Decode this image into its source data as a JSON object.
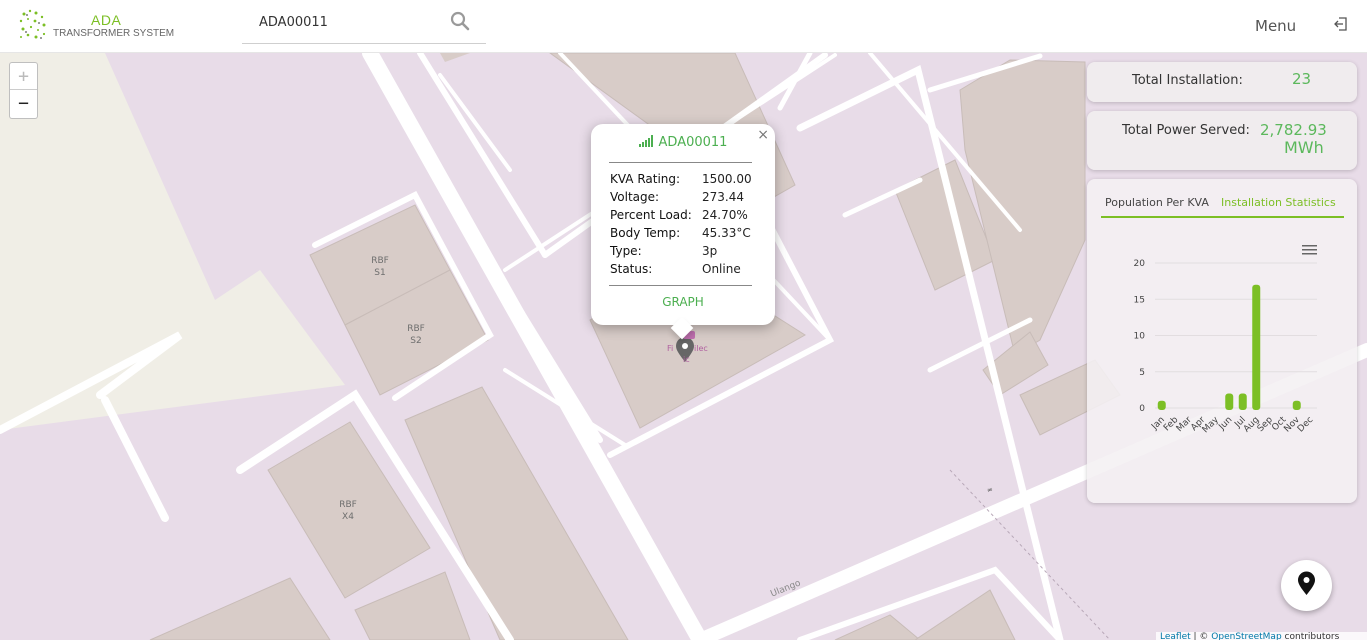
{
  "header": {
    "logo_title": "ADA",
    "logo_subtitle": "TRANSFORMER SYSTEM",
    "search_value": "ADA00011",
    "menu_label": "Menu"
  },
  "map": {
    "zoom_in": "+",
    "zoom_out": "−",
    "labels": [
      {
        "text": "RBF\nS1"
      },
      {
        "text": "RBF\nS2"
      },
      {
        "text": "RBF\nX4"
      },
      {
        "text": "Ulango"
      }
    ],
    "attribution": {
      "leaflet": "Leaflet",
      "sep": " | © ",
      "osm": "OpenStreetMap",
      "rest": " contributors"
    }
  },
  "popup": {
    "close": "×",
    "title": "ADA00011",
    "rows": [
      {
        "label": "KVA Rating:",
        "value": "1500.00"
      },
      {
        "label": "Voltage:",
        "value": "273.44"
      },
      {
        "label": "Percent Load:",
        "value": "24.70%"
      },
      {
        "label": "Body Temp:",
        "value": "45.33°C"
      },
      {
        "label": "Type:",
        "value": "3p"
      },
      {
        "label": "Status:",
        "value": "Online"
      }
    ],
    "graph_label": "GRAPH"
  },
  "stats": {
    "total_installation_label": "Total Installation:",
    "total_installation_value": "23",
    "total_power_label": "Total Power Served:",
    "total_power_value": "2,782.93",
    "total_power_unit": "MWh"
  },
  "tabs": [
    {
      "label": "Population Per KVA",
      "active": false
    },
    {
      "label": "Installation Statistics",
      "active": true
    }
  ],
  "colors": {
    "accent": "#7cbf25",
    "value_green": "#5cb85c",
    "map_bg": "#e8dce8",
    "building": "#d8ccc8"
  },
  "icons": {
    "search": "search-icon",
    "logout": "logout-icon",
    "menu": "hamburger-icon",
    "locate": "location-pin-icon",
    "signal": "signal-icon"
  },
  "chart_data": {
    "type": "bar",
    "categories": [
      "Jan",
      "Feb",
      "Mar",
      "Apr",
      "May",
      "Jun",
      "Jul",
      "Aug",
      "Sep",
      "Oct",
      "Nov",
      "Dec"
    ],
    "values": [
      1,
      0,
      0,
      0,
      0,
      2,
      2,
      17,
      0,
      0,
      1,
      0
    ],
    "yticks": [
      0,
      5,
      10,
      15,
      20
    ],
    "ylim": [
      0,
      20
    ],
    "grid": true,
    "color": "#7cbf25"
  }
}
